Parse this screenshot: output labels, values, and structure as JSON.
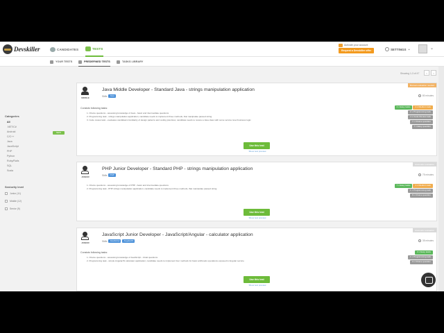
{
  "brand": {
    "name": "Devskiller"
  },
  "nav": {
    "candidates": "CANDIDATES",
    "tests": "TESTS"
  },
  "promo": {
    "line": "Activate your account",
    "button": "Request a Devskiller offer"
  },
  "settings": {
    "label": "SETTINGS"
  },
  "subnav": {
    "your_tests": "YOUR TESTS",
    "predefined": "PREDEFINED TESTS",
    "library": "TASKS LIBRARY"
  },
  "sidebar": {
    "categories_title": "Categories",
    "categories": [
      "All",
      ".NET/C#",
      "Android",
      "C/C++",
      "Java",
      "JavaScript",
      "PHP",
      "Python",
      "Ruby/Rails",
      "SQL",
      "Scala"
    ],
    "new_badge": "NEW",
    "seniority_title": "Seniority level",
    "seniority": [
      "Junior (11)",
      "Middle (12)",
      "Senior (9)"
    ]
  },
  "pagination": {
    "showing": "Showing 1-3 of 47",
    "prev": "‹",
    "next": "›"
  },
  "cards": [
    {
      "ribbon": "Manual evaluation needed",
      "level": "MIDDLE",
      "title": "Java Middle Developer - Standard Java - strings manipulation application",
      "skills_label": "Skills",
      "skills": [
        "Java"
      ],
      "duration": "80 minutes",
      "consists": "Consists following tasks:",
      "tasks": [
        "1. Choice questions - assessing knowledge of Java - basic and intermediate questions",
        "2. Programming task - strings manipulation application; candidate needs to implement three methods, that manipulate passed string",
        "3. Code review task - evaluates candidate's familiarity of design patterns and coding practices; candidate needs to review a Java class with some service level business logic"
      ],
      "tags": [
        [
          "4 x Easy tasks",
          "1 x Medium task"
        ],
        [
          "2 x Programming task"
        ],
        [
          "1 x Code Review task"
        ],
        [
          "7 x Choice question"
        ],
        [
          "7 x Easy question"
        ]
      ],
      "use_button": "Use this test",
      "preview": "Show test preview"
    },
    {
      "ribbon": "Automatic evaluation",
      "level": "JUNIOR",
      "title": "PHP Junior Developer - Standard PHP - strings manipulation application",
      "skills_label": "Skills",
      "skills": [
        "PHP"
      ],
      "duration": "75 minutes",
      "consists": "",
      "tasks": [
        "1. Choice questions - assessing knowledge of PHP - basic and intermediate questions",
        "2. Programming task - PHP strings manipulation application; candidate needs to implement three methods, that manipulate passed string"
      ],
      "tags": [
        [
          "7 x Easy tasks",
          "1 x Medium task"
        ],
        [
          "1 x Programming task"
        ],
        [
          "8 x Choice question"
        ]
      ],
      "use_button": "Use this test",
      "preview": "Show test preview"
    },
    {
      "ribbon": "Automatic evaluation",
      "level": "JUNIOR",
      "title": "JavaScript Junior Developer - JavaScript/Angular - calculator application",
      "skills_label": "Skills",
      "skills": [
        "JavaScript",
        "AngularJS"
      ],
      "duration": "35 minutes",
      "consists": "Consists following tasks:",
      "tasks": [
        "1. Choice questions - assessing knowledge of JavaScript - trivial questions",
        "2. Programming task - simple AngularJS calculator application; candidate needs to implement four methods for basic arithmetic operations exposed in Angular service"
      ],
      "tags": [
        [
          "4 x Easy tasks"
        ],
        [
          "1 x Programming task"
        ],
        [
          "3 x Choice question"
        ]
      ],
      "use_button": "Use this test",
      "preview": "Show test preview"
    }
  ]
}
